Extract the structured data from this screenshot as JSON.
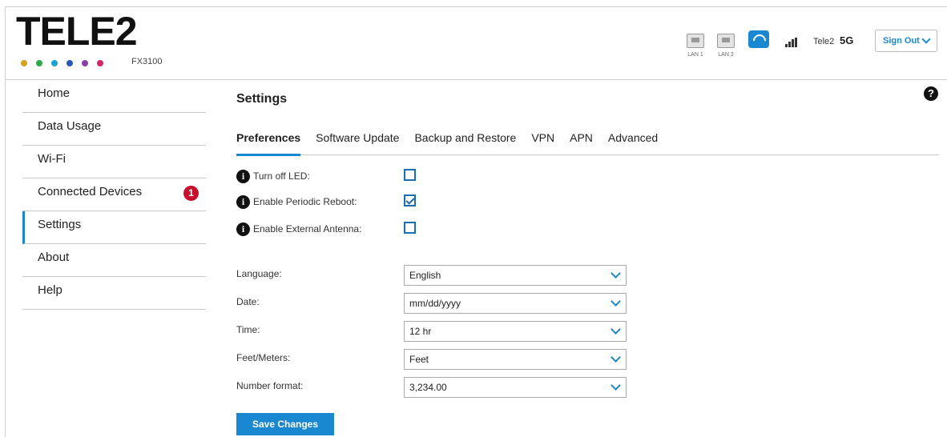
{
  "brand": {
    "logo": "TELE2",
    "model": "FX3100",
    "dot_colors": [
      "#d8a21c",
      "#2ea84a",
      "#1aa0d8",
      "#2a58b8",
      "#8a3fa8",
      "#d8256a"
    ]
  },
  "status_bar": {
    "lan1_label": "LAN 1",
    "lan2_label": "LAN 2",
    "carrier": "Tele2",
    "network": "5G",
    "sign_out": "Sign Out"
  },
  "sidebar": {
    "items": [
      {
        "label": "Home"
      },
      {
        "label": "Data Usage"
      },
      {
        "label": "Wi-Fi"
      },
      {
        "label": "Connected Devices",
        "badge": "1"
      },
      {
        "label": "Settings",
        "active": true
      },
      {
        "label": "About"
      },
      {
        "label": "Help"
      }
    ]
  },
  "main": {
    "title": "Settings",
    "help": "?",
    "tabs": [
      {
        "label": "Preferences",
        "active": true
      },
      {
        "label": "Software Update"
      },
      {
        "label": "Backup and Restore"
      },
      {
        "label": "VPN"
      },
      {
        "label": "APN"
      },
      {
        "label": "Advanced"
      }
    ],
    "options": [
      {
        "label": "Turn off LED:",
        "checked": false
      },
      {
        "label": "Enable Periodic Reboot:",
        "checked": true
      },
      {
        "label": "Enable External Antenna:",
        "checked": false
      }
    ],
    "info_glyph": "i",
    "fields": [
      {
        "label": "Language:",
        "value": "English"
      },
      {
        "label": "Date:",
        "value": "mm/dd/yyyy"
      },
      {
        "label": "Time:",
        "value": "12 hr"
      },
      {
        "label": "Feet/Meters:",
        "value": "Feet"
      },
      {
        "label": "Number format:",
        "value": "3,234.00"
      }
    ],
    "save_label": "Save Changes"
  },
  "colors": {
    "accent": "#1a88d0",
    "badge": "#c8102e"
  }
}
